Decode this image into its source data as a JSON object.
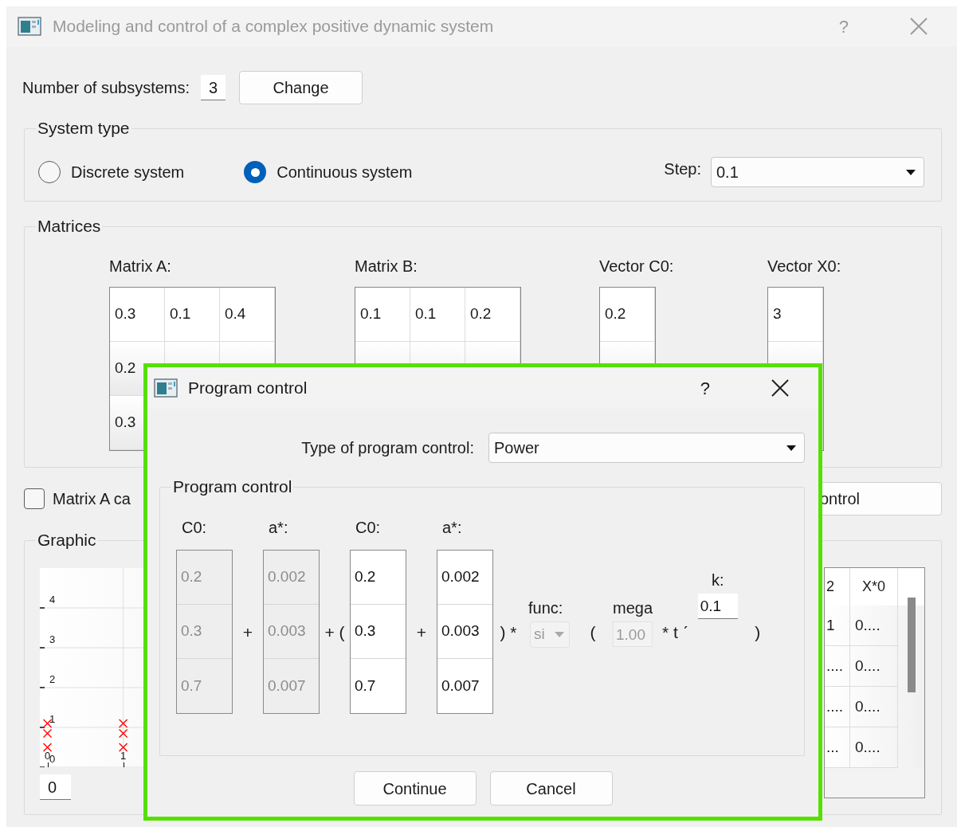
{
  "window": {
    "title": "Modeling and control of a complex positive dynamic system",
    "help": "?"
  },
  "subsystems": {
    "label": "Number of subsystems:",
    "value": "3",
    "button": "Change"
  },
  "system_type": {
    "title": "System type",
    "options": [
      {
        "label": "Discrete system",
        "selected": false
      },
      {
        "label": "Continuous system",
        "selected": true
      }
    ],
    "step_label": "Step:",
    "step_value": "0.1"
  },
  "matrices": {
    "title": "Matrices",
    "blocks": [
      {
        "label": "Matrix A:",
        "rows": [
          [
            "0.3",
            "0.1",
            "0.4"
          ],
          [
            "0.2"
          ],
          [
            "0.3"
          ]
        ]
      },
      {
        "label": "Matrix B:",
        "rows": [
          [
            "0.1",
            "0.1",
            "0.2"
          ]
        ]
      },
      {
        "label": "Vector C0:",
        "rows": [
          [
            "0.2"
          ]
        ]
      },
      {
        "label": "Vector X0:",
        "rows": [
          [
            "3"
          ]
        ]
      }
    ]
  },
  "matrix_checkbox": {
    "label": "Matrix A ca",
    "checked": false
  },
  "control_button": "ontrol",
  "graphic": {
    "title": "Graphic",
    "field": "0",
    "chart_data": {
      "type": "scatter",
      "x": [
        0,
        1
      ],
      "series": [
        {
          "color": "#ff0000",
          "values": [
            1.1,
            1.1
          ]
        },
        {
          "color": "#ff0000",
          "values": [
            0.85,
            0.85
          ]
        },
        {
          "color": "#ff0000",
          "values": [
            0.5,
            0.5
          ]
        }
      ],
      "xticks": [
        0,
        1
      ],
      "yticks": [
        0,
        1,
        2,
        3,
        4
      ],
      "xlim": [
        -0.1,
        10.1
      ],
      "ylim": [
        0,
        5
      ],
      "grid": true
    },
    "table": {
      "columns": [
        "2",
        "X*0"
      ],
      "rows": [
        [
          "1",
          "0...."
        ],
        [
          "....",
          "0...."
        ],
        [
          "....",
          "0...."
        ],
        [
          "...",
          "0...."
        ]
      ]
    }
  },
  "dialog": {
    "title": "Program control",
    "help": "?",
    "type_label": "Type of program control:",
    "type_value": "Power",
    "group_title": "Program control",
    "formula": [
      {
        "kind": "vector",
        "label": "C0:",
        "disabled": true,
        "values": [
          "0.2",
          "0.3",
          "0.7"
        ]
      },
      {
        "kind": "op",
        "text": "+"
      },
      {
        "kind": "vector",
        "label": "a*:",
        "disabled": true,
        "values": [
          "0.002",
          "0.003",
          "0.007"
        ]
      },
      {
        "kind": "op",
        "text": "+ ("
      },
      {
        "kind": "vector",
        "label": "C0:",
        "disabled": false,
        "values": [
          "0.2",
          "0.3",
          "0.7"
        ]
      },
      {
        "kind": "op",
        "text": "+"
      },
      {
        "kind": "vector",
        "label": "a*:",
        "disabled": false,
        "values": [
          "0.002",
          "0.003",
          "0.007"
        ]
      },
      {
        "kind": "op",
        "text": ") *"
      },
      {
        "kind": "combo",
        "label": "func:",
        "value": "si",
        "disabled": true
      },
      {
        "kind": "op",
        "text": "("
      },
      {
        "kind": "field",
        "label": "mega",
        "value": "1.00",
        "disabled": true
      },
      {
        "kind": "op",
        "text": "* t ˊ"
      },
      {
        "kind": "exponent",
        "label": "k:",
        "value": "0.1",
        "disabled": false
      },
      {
        "kind": "op",
        "text": ")"
      }
    ],
    "buttons": [
      "Continue",
      "Cancel"
    ]
  }
}
